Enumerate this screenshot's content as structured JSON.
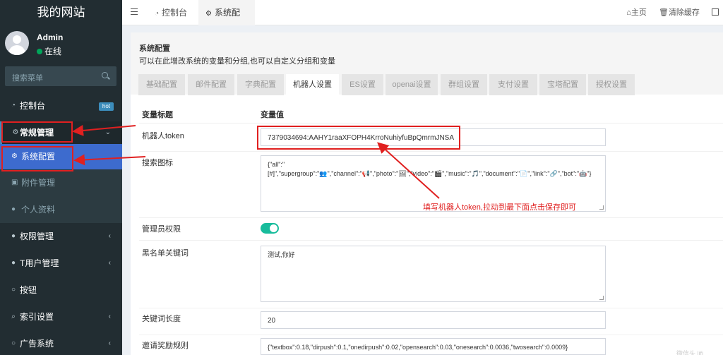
{
  "sidebar": {
    "logo": "我的网站",
    "user": {
      "name": "Admin",
      "status": "在线"
    },
    "search_placeholder": "搜索菜单",
    "items": [
      {
        "label": "控制台",
        "icon": "dashboard-icon",
        "badge": "hot"
      },
      {
        "label": "常规管理",
        "icon": "cogs-icon"
      },
      {
        "label": "系统配置",
        "icon": "gear-icon"
      },
      {
        "label": "附件管理",
        "icon": "image-icon"
      },
      {
        "label": "个人资料",
        "icon": "user-icon"
      },
      {
        "label": "权限管理",
        "icon": "group-icon"
      },
      {
        "label": "T用户管理",
        "icon": "user-icon"
      },
      {
        "label": "按钮",
        "icon": "circle-icon"
      },
      {
        "label": "索引设置",
        "icon": "search-icon"
      },
      {
        "label": "广告系统",
        "icon": "circle-icon"
      }
    ]
  },
  "topbar": {
    "tabs": [
      {
        "label": "控制台",
        "icon": "dashboard-icon"
      },
      {
        "label": "系统配置",
        "icon": "gear-icon"
      }
    ],
    "home_label": "主页",
    "clear_cache_label": "清除缓存"
  },
  "page": {
    "title": "系统配置",
    "subtitle": "可以在此增改系统的变量和分组,也可以自定义分组和变量",
    "tabs": [
      "基础配置",
      "邮件配置",
      "字典配置",
      "机器人设置",
      "ES设置",
      "openai设置",
      "群组设置",
      "支付设置",
      "宝塔配置",
      "授权设置"
    ],
    "active_tab": "机器人设置",
    "col_title": "变量标题",
    "col_value": "变量值",
    "rows": [
      {
        "label": "机器人token",
        "value": "7379034694:AAHY1raaXFOPH4KrroNuhiyfuBpQmrmJNSA"
      },
      {
        "label": "搜索图标",
        "value": "{\"all\":\"[#]\",\"supergroup\":\"👥\",\"channel\":\"📢\",\"photo\":\"🖼\",\"video\":\"🎬\",\"music\":\"🎵\",\"document\":\"📄\",\"link\":\"🔗\",\"bot\":\"🤖\"}"
      },
      {
        "label": "管理员权限",
        "value": "on"
      },
      {
        "label": "黑名单关键词",
        "value": "测试,你好"
      },
      {
        "label": "关键词长度",
        "value": "20"
      },
      {
        "label": "邀请奖励规则",
        "value": "{\"textbox\":0.18,\"dirpush\":0.1,\"onedirpush\":0.02,\"opensearch\":0.03,\"onesearch\":0.0036,\"twosearch\":0.0009}"
      }
    ]
  },
  "annotation": {
    "text": "填写机器人token,拉动到最下面点击保存即可",
    "color": "#e02020"
  },
  "watermark": "微信头 lifi"
}
